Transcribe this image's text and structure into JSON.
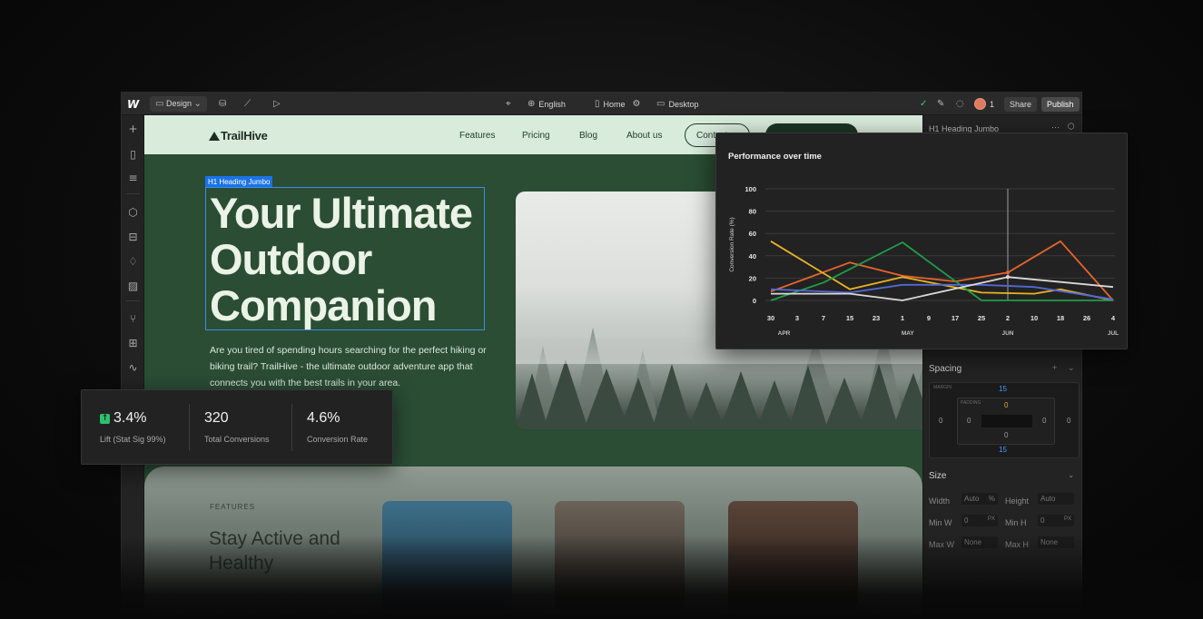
{
  "topbar": {
    "logo": "W",
    "mode_label": "Design",
    "language": "English",
    "page": "Home",
    "breakpoint": "Desktop",
    "collaborators_count": "1",
    "share_label": "Share",
    "publish_label": "Publish"
  },
  "site": {
    "brand": "TrailHive",
    "nav_links": [
      "Features",
      "Pricing",
      "Blog",
      "About us"
    ],
    "nav_button_outline": "Contact",
    "hero_tag": "H1  Heading Jumbo",
    "hero_title": "Your Ultimate Outdoor Companion",
    "hero_subtitle": "Are you tired of spending hours searching for the perfect hiking or biking trail? TrailHive - the ultimate outdoor adventure app that connects you with the best trails in your area.",
    "features_label": "FEATURES",
    "features_title": "Stay Active and Healthy"
  },
  "right_panel": {
    "selected_element": "H1  Heading Jumbo",
    "spacing_label": "Spacing",
    "margin_label": "MARGIN",
    "padding_label": "PADDING",
    "margin_top": "15",
    "margin_bottom": "15",
    "margin_left": "0",
    "margin_right": "0",
    "padding_top": "0",
    "padding_bottom": "0",
    "padding_left": "0",
    "padding_right": "0",
    "size_label": "Size",
    "width_label": "Width",
    "width_value": "Auto",
    "height_label": "Height",
    "height_value": "Auto",
    "min_w_label": "Min W",
    "min_w_value": "0",
    "min_h_label": "Min H",
    "min_h_value": "0",
    "max_w_label": "Max W",
    "max_w_value": "None",
    "max_h_label": "Max H",
    "max_h_value": "None",
    "unit_px": "PX",
    "unit_pct": "%"
  },
  "stats": [
    {
      "value": "3.4%",
      "label": "Lift (Stat Sig 99%)",
      "trend": "up"
    },
    {
      "value": "320",
      "label": "Total Conversions"
    },
    {
      "value": "4.6%",
      "label": "Conversion Rate"
    }
  ],
  "colors": {
    "chart_orange": "#e8642c",
    "chart_yellow": "#e8b423",
    "chart_green": "#1e9e4a",
    "chart_blue": "#5468d4",
    "chart_white": "#d9d9d9",
    "selection_blue": "#1a73e8",
    "site_nav_bg": "#d9ecdc",
    "hero_bg": "#2a4d34"
  },
  "chart_data": {
    "type": "line",
    "title": "Performance over time",
    "ylabel": "Conversion Rate (%)",
    "ylim": [
      0,
      100
    ],
    "yticks": [
      "0",
      "20",
      "40",
      "60",
      "80",
      "100"
    ],
    "x": [
      "30",
      "3",
      "7",
      "15",
      "23",
      "1",
      "9",
      "17",
      "25",
      "2",
      "10",
      "18",
      "26",
      "4"
    ],
    "month_labels": [
      {
        "label": "APR",
        "at": 0.5
      },
      {
        "label": "MAY",
        "at": 5.2
      },
      {
        "label": "JUN",
        "at": 9.0
      },
      {
        "label": "JUL",
        "at": 13.0
      }
    ],
    "cursor_index": 9,
    "grid": true,
    "series": [
      {
        "color": "#e8642c",
        "values": [
          [
            0,
            8
          ],
          [
            3,
            34
          ],
          [
            5,
            22
          ],
          [
            7,
            17
          ],
          [
            9,
            25
          ],
          [
            11,
            53
          ],
          [
            13,
            0
          ]
        ]
      },
      {
        "color": "#e8b423",
        "values": [
          [
            0,
            53
          ],
          [
            3,
            10
          ],
          [
            5,
            21
          ],
          [
            8,
            7
          ],
          [
            10,
            6
          ],
          [
            11,
            10
          ],
          [
            13,
            0
          ]
        ]
      },
      {
        "color": "#1e9e4a",
        "values": [
          [
            0,
            0
          ],
          [
            2,
            16
          ],
          [
            5,
            52
          ],
          [
            8,
            0
          ],
          [
            13,
            0
          ]
        ]
      },
      {
        "color": "#5468d4",
        "values": [
          [
            0,
            10
          ],
          [
            3,
            7
          ],
          [
            5,
            14
          ],
          [
            8,
            14
          ],
          [
            10,
            12
          ],
          [
            13,
            1
          ]
        ]
      },
      {
        "color": "#d9d9d9",
        "values": [
          [
            0,
            6
          ],
          [
            3,
            6
          ],
          [
            5,
            0
          ],
          [
            9,
            21
          ],
          [
            13,
            12
          ]
        ]
      }
    ]
  }
}
